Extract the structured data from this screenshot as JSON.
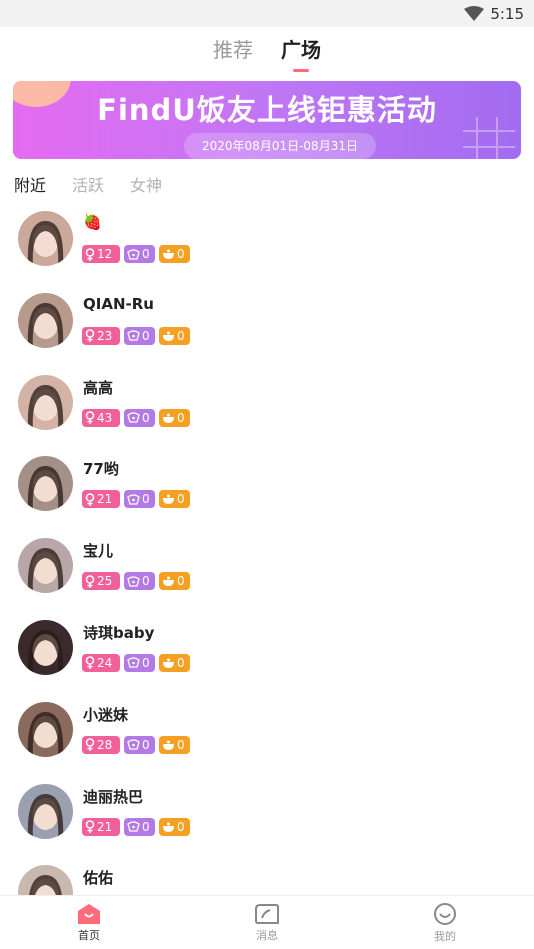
{
  "status": {
    "time": "5:15",
    "wifi_icon": "wifi-icon"
  },
  "topnav": {
    "tabs": [
      {
        "label": "推荐",
        "active": false
      },
      {
        "label": "广场",
        "active": true
      }
    ]
  },
  "banner": {
    "title": "FindU饭友上线钜惠活动",
    "date": "2020年08月01日-08月31日"
  },
  "subtabs": [
    {
      "label": "附近",
      "active": true
    },
    {
      "label": "活跃",
      "active": false
    },
    {
      "label": "女神",
      "active": false
    }
  ],
  "users": [
    {
      "name": "🍓",
      "age": "12",
      "level": "0",
      "pot": "0",
      "avatar_color": "#caa89a"
    },
    {
      "name": "QIAN-Ru",
      "age": "23",
      "level": "0",
      "pot": "0",
      "avatar_color": "#b89a8c"
    },
    {
      "name": "高高",
      "age": "43",
      "level": "0",
      "pot": "0",
      "avatar_color": "#d3b3a6"
    },
    {
      "name": "77哟",
      "age": "21",
      "level": "0",
      "pot": "0",
      "avatar_color": "#a59088"
    },
    {
      "name": "宝儿",
      "age": "25",
      "level": "0",
      "pot": "0",
      "avatar_color": "#b8a6a8"
    },
    {
      "name": "诗琪baby",
      "age": "24",
      "level": "0",
      "pot": "0",
      "avatar_color": "#3a2a2c"
    },
    {
      "name": "小迷妹",
      "age": "28",
      "level": "0",
      "pot": "0",
      "avatar_color": "#8a6a5c"
    },
    {
      "name": "迪丽热巴",
      "age": "21",
      "level": "0",
      "pot": "0",
      "avatar_color": "#9aa0b0"
    },
    {
      "name": "佑佑",
      "age": "",
      "level": "",
      "pot": "",
      "avatar_color": "#c9b8ae"
    }
  ],
  "bottomnav": [
    {
      "label": "首页",
      "icon": "home-icon",
      "active": true
    },
    {
      "label": "消息",
      "icon": "message-icon",
      "active": false
    },
    {
      "label": "我的",
      "icon": "profile-icon",
      "active": false
    }
  ],
  "colors": {
    "accent": "#ff6b78",
    "age_badge": "#f2609a",
    "level_badge": "#b37ae6",
    "pot_badge": "#f5a023"
  }
}
